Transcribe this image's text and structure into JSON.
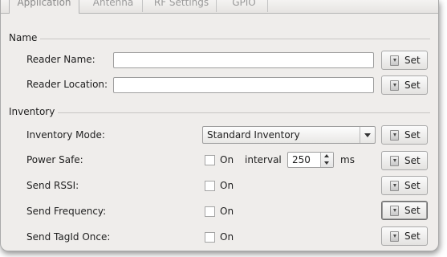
{
  "tabs": [
    {
      "label": "Application"
    },
    {
      "label": "Antenna"
    },
    {
      "label": "RF Settings"
    },
    {
      "label": "GPIO"
    }
  ],
  "name_group": {
    "title": "Name",
    "reader_name_label": "Reader Name:",
    "reader_name_value": "",
    "reader_location_label": "Reader Location:",
    "reader_location_value": ""
  },
  "inventory_group": {
    "title": "Inventory",
    "mode_label": "Inventory Mode:",
    "mode_value": "Standard Inventory",
    "power_safe_label": "Power Safe:",
    "power_safe_checked": false,
    "power_safe_on": "On",
    "interval_label": "interval",
    "interval_value": "250",
    "interval_unit": "ms",
    "send_rssi_label": "Send RSSI:",
    "send_rssi_checked": false,
    "send_rssi_on": "On",
    "send_frequency_label": "Send Frequency:",
    "send_frequency_checked": false,
    "send_frequency_on": "On",
    "send_tagid_label": "Send TagId Once:",
    "send_tagid_checked": false,
    "send_tagid_on": "On"
  },
  "buttons": {
    "set_label": "Set",
    "icon": "download-arrow-icon"
  }
}
